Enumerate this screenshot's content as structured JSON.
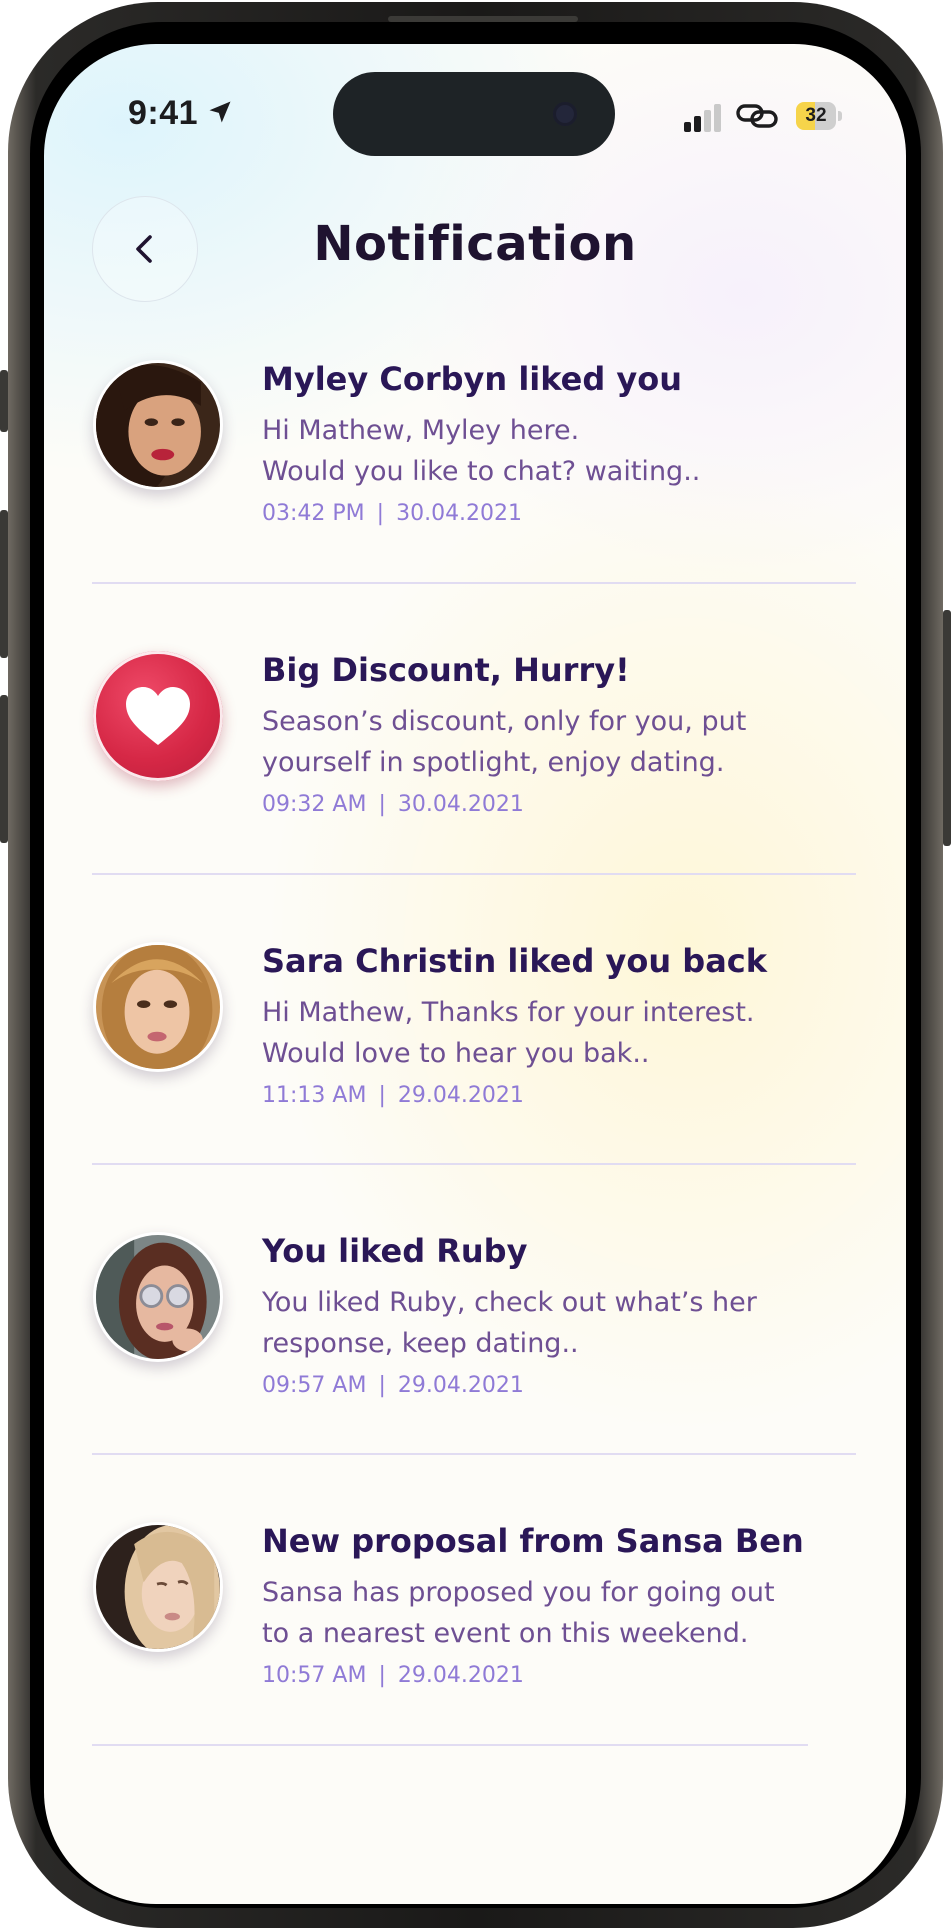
{
  "status_bar": {
    "time": "9:41",
    "battery": "32",
    "icons": [
      "location-arrow-icon",
      "cellular-signal-icon",
      "link-icon",
      "battery-icon"
    ]
  },
  "header": {
    "title": "Notification",
    "back_icon": "chevron-left-icon"
  },
  "colors": {
    "title": "#1f1330",
    "item_title": "#2a1757",
    "item_body": "#6e4f93",
    "item_meta": "#8f7ad6",
    "divider": "#e1dcf2",
    "heart_badge": "#d62846"
  },
  "notifications": [
    {
      "icon": "avatar",
      "title": "Myley Corbyn liked you",
      "body": [
        "Hi Mathew, Myley here.",
        "Would you like to chat? waiting.."
      ],
      "time": "03:42 PM",
      "date": "30.04.2021"
    },
    {
      "icon": "heart-icon",
      "title": "Big Discount, Hurry!",
      "body": [
        "Season’s discount, only for you, put",
        "yourself in spotlight, enjoy dating."
      ],
      "time": "09:32 AM",
      "date": "30.04.2021"
    },
    {
      "icon": "avatar",
      "title": "Sara Christin liked you back",
      "body": [
        "Hi Mathew, Thanks for your interest.",
        "Would love to hear you bak.."
      ],
      "time": "11:13 AM",
      "date": "29.04.2021"
    },
    {
      "icon": "avatar",
      "title": "You liked Ruby",
      "body": [
        "You liked Ruby, check out what’s her",
        "response, keep dating.."
      ],
      "time": "09:57 AM",
      "date": "29.04.2021"
    },
    {
      "icon": "avatar",
      "title": "New proposal from Sansa Ben",
      "body": [
        "Sansa has proposed you for going out",
        "to a nearest event on this weekend."
      ],
      "time": "10:57 AM",
      "date": "29.04.2021"
    }
  ]
}
